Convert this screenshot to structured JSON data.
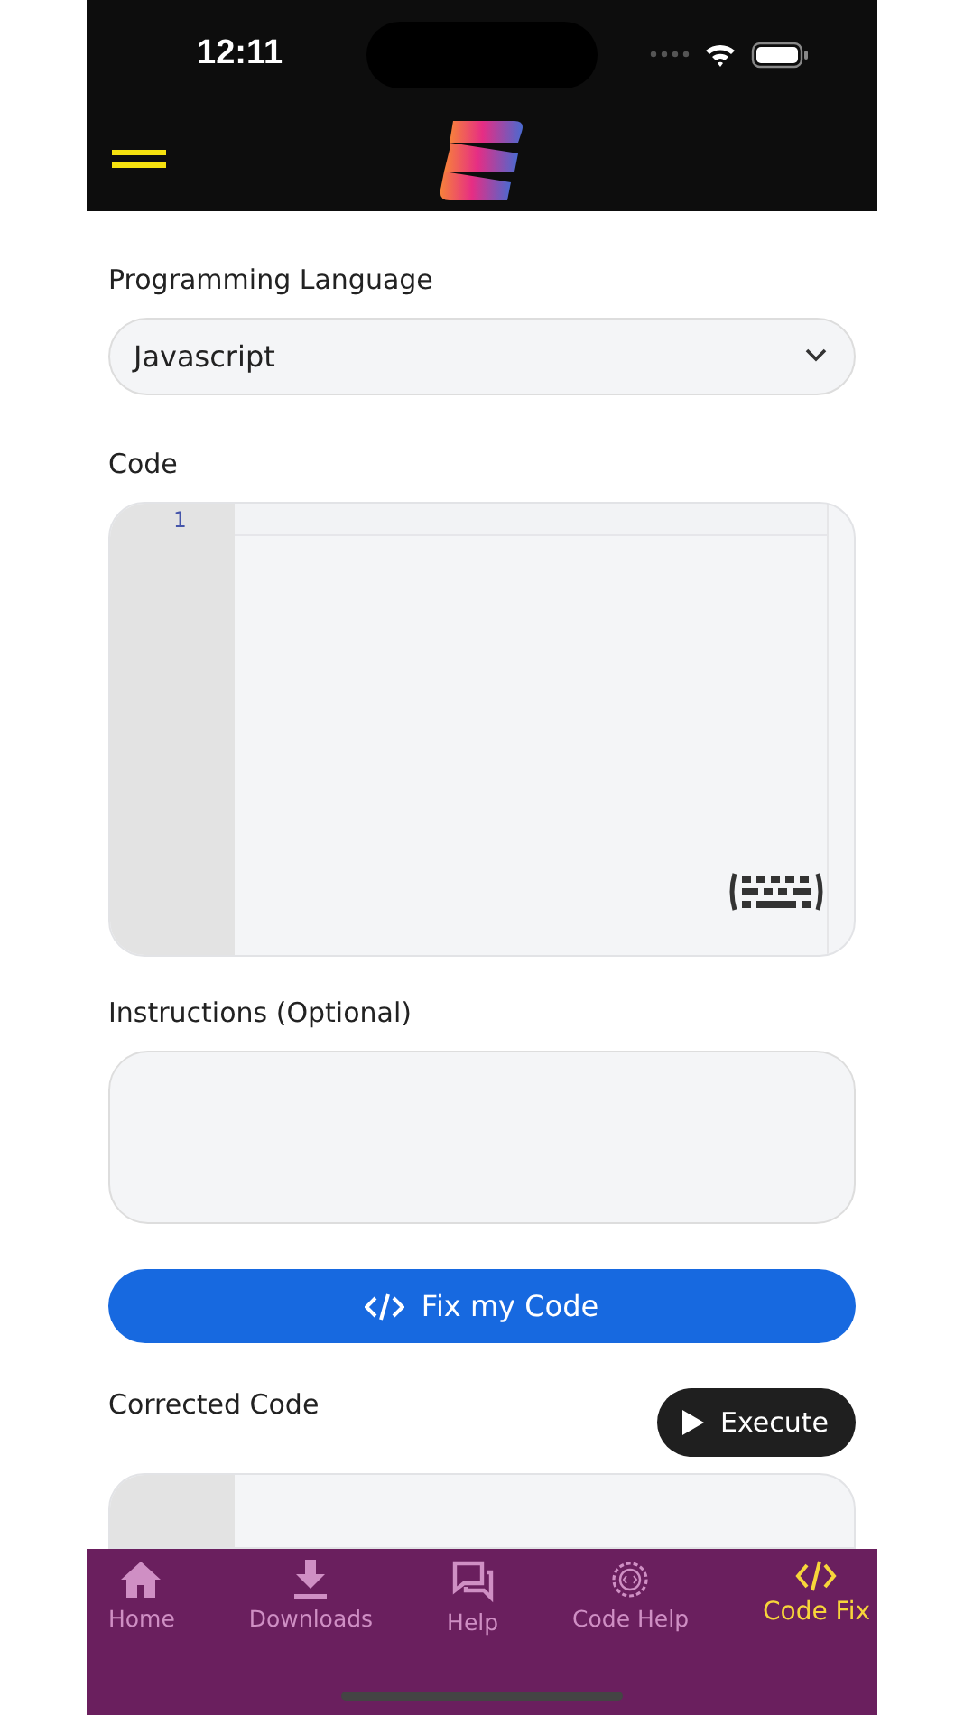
{
  "status_bar": {
    "time": "12:11"
  },
  "language": {
    "label": "Programming Language",
    "value": "Javascript"
  },
  "code": {
    "label": "Code",
    "line_numbers": [
      "1"
    ]
  },
  "instructions": {
    "label": "Instructions (Optional)"
  },
  "fix_button": "Fix my Code",
  "corrected": {
    "label": "Corrected Code",
    "execute_button": "Execute"
  },
  "tabs": [
    {
      "label": "Home",
      "selected": false
    },
    {
      "label": "Downloads",
      "selected": false
    },
    {
      "label": "Help",
      "selected": false
    },
    {
      "label": "Code Help",
      "selected": false
    },
    {
      "label": "Code Fix",
      "selected": true
    }
  ]
}
